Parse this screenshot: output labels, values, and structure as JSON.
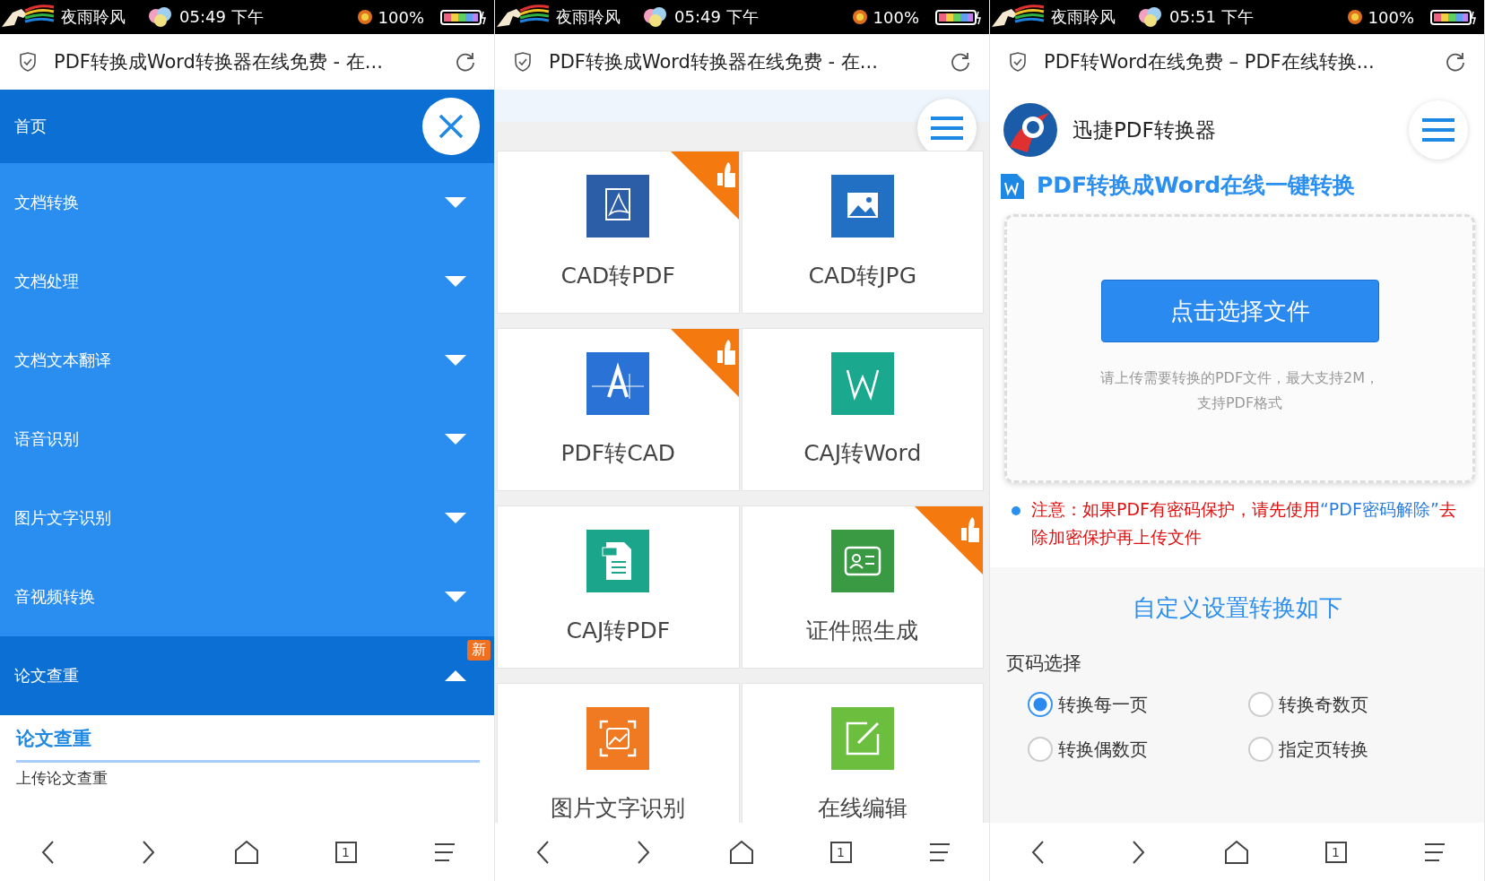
{
  "panels": [
    {
      "kind": "menu",
      "status": {
        "carrier": "夜雨聆风",
        "time": "05:49 下午",
        "battery": "100%"
      },
      "address": {
        "title": "PDF转换成Word转换器在线免费 - 在..."
      },
      "menu": {
        "header": "首页",
        "items": [
          {
            "label": "文档转换",
            "expanded": false
          },
          {
            "label": "文档处理",
            "expanded": false
          },
          {
            "label": "文档文本翻译",
            "expanded": false
          },
          {
            "label": "语音识别",
            "expanded": false
          },
          {
            "label": "图片文字识别",
            "expanded": false
          },
          {
            "label": "音视频转换",
            "expanded": false
          },
          {
            "label": "论文查重",
            "expanded": true,
            "badge": "新",
            "children": {
              "heading": "论文查重",
              "items": [
                "上传论文查重"
              ]
            }
          }
        ]
      },
      "nav": {
        "tab_count": "1"
      }
    },
    {
      "kind": "tools",
      "status": {
        "carrier": "夜雨聆风",
        "time": "05:49 下午",
        "battery": "100%"
      },
      "address": {
        "title": "PDF转换成Word转换器在线免费 - 在..."
      },
      "tiles": [
        {
          "label": "CAD转PDF",
          "hot": true,
          "kind": "pdf",
          "color": "#2b5ea7"
        },
        {
          "label": "CAD转JPG",
          "hot": false,
          "kind": "image",
          "color": "#2170c4"
        },
        {
          "label": "PDF转CAD",
          "hot": true,
          "kind": "cad",
          "color": "#2a72d6"
        },
        {
          "label": "CAJ转Word",
          "hot": false,
          "kind": "word",
          "color": "#1aa88e"
        },
        {
          "label": "CAJ转PDF",
          "hot": false,
          "kind": "doc",
          "color": "#1ba58a"
        },
        {
          "label": "证件照生成",
          "hot": true,
          "kind": "idcard",
          "color": "#3a9a44"
        },
        {
          "label": "图片文字识别",
          "hot": false,
          "kind": "scan",
          "color": "#f07a22"
        },
        {
          "label": "在线编辑",
          "hot": false,
          "kind": "edit",
          "color": "#6cbf3e"
        }
      ],
      "nav": {
        "tab_count": "1"
      }
    },
    {
      "kind": "converter",
      "status": {
        "carrier": "夜雨聆风",
        "time": "05:51 下午",
        "battery": "100%"
      },
      "address": {
        "title": "PDF转Word在线免费 – PDF在线转换..."
      },
      "brand": "迅捷PDF转换器",
      "heading": "PDF转换成Word在线一键转换",
      "upload_button": "点击选择文件",
      "hint_lines": [
        "请上传需要转换的PDF文件，最大支持2M，",
        "支持PDF格式"
      ],
      "notice": {
        "before": "注意：如果PDF有密码保护，请先使用",
        "link": "“PDF密码解除”",
        "after": "去除加密保护再上传文件"
      },
      "settings": {
        "title": "自定义设置转换如下",
        "label": "页码选择",
        "options": [
          {
            "label": "转换每一页",
            "selected": true
          },
          {
            "label": "转换奇数页",
            "selected": false
          },
          {
            "label": "转换偶数页",
            "selected": false
          },
          {
            "label": "指定页转换",
            "selected": false
          }
        ]
      },
      "nav": {
        "tab_count": "1"
      }
    }
  ]
}
